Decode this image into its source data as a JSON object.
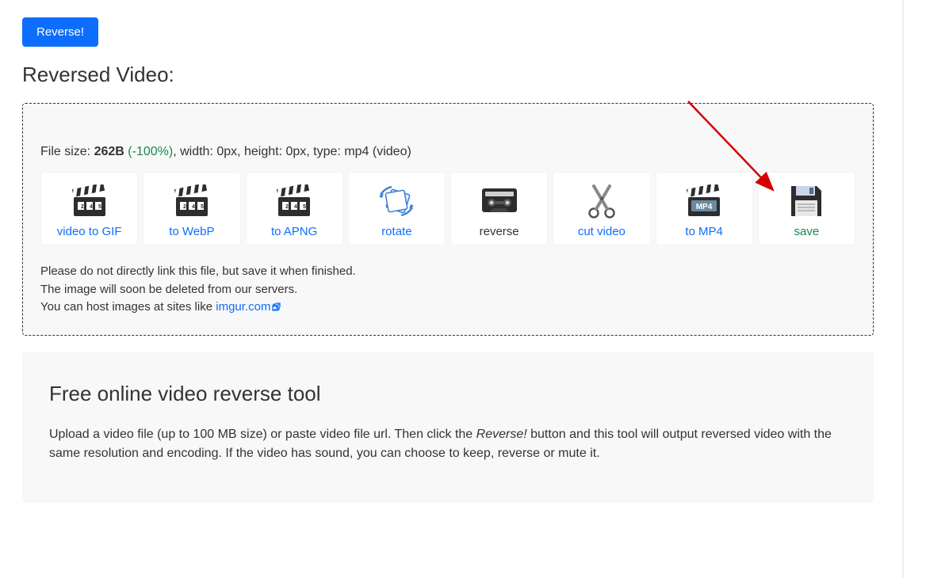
{
  "buttons": {
    "reverse": "Reverse!"
  },
  "section_title": "Reversed Video:",
  "file_info": {
    "prefix": "File size: ",
    "size": "262B",
    "percent": " (-100%)",
    "rest": ", width: 0px, height: 0px, type: mp4 (video)"
  },
  "actions": [
    {
      "key": "video-to-gif",
      "label": "video to GIF",
      "type": "link"
    },
    {
      "key": "to-webp",
      "label": "to WebP",
      "type": "link"
    },
    {
      "key": "to-apng",
      "label": "to APNG",
      "type": "link"
    },
    {
      "key": "rotate",
      "label": "rotate",
      "type": "link"
    },
    {
      "key": "reverse",
      "label": "reverse",
      "type": "normal"
    },
    {
      "key": "cut-video",
      "label": "cut video",
      "type": "link"
    },
    {
      "key": "to-mp4",
      "label": "to MP4",
      "type": "link"
    },
    {
      "key": "save",
      "label": "save",
      "type": "save"
    }
  ],
  "notice": {
    "line1": "Please do not directly link this file, but save it when finished.",
    "line2": "The image will soon be deleted from our servers.",
    "line3_a": "You can host images at sites like ",
    "link_text": "imgur.com"
  },
  "info": {
    "heading": "Free online video reverse tool",
    "p_a": "Upload a video file (up to 100 MB size) or paste video file url. Then click the ",
    "p_em": "Reverse!",
    "p_b": " button and this tool will output reversed video with the same resolution and encoding. If the video has sound, you can choose to keep, reverse or mute it."
  }
}
